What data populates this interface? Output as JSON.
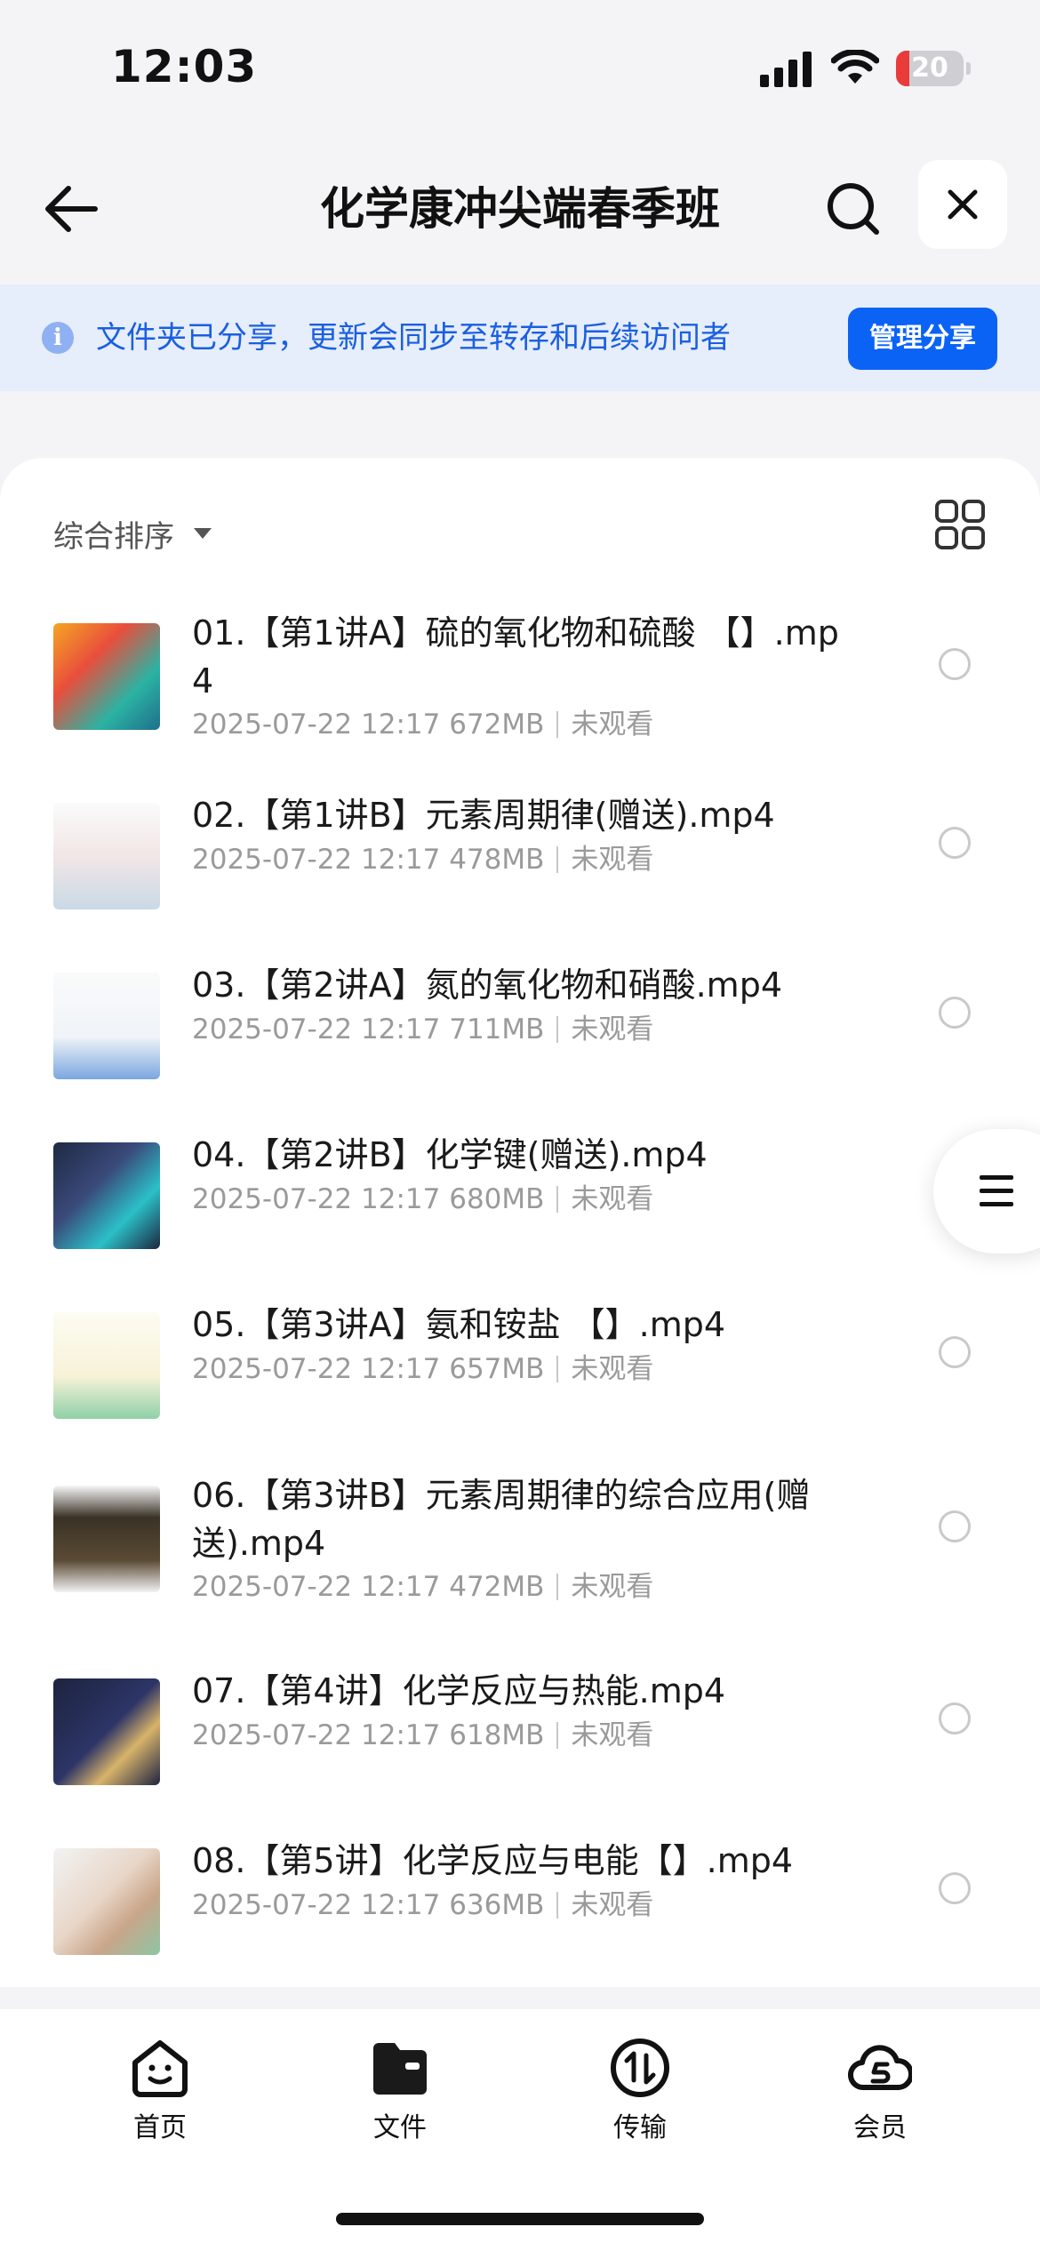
{
  "status_bar": {
    "time": "12:03",
    "battery_level": "20",
    "battery_fraction": 0.2,
    "icons": [
      "signal-icon",
      "wifi-icon",
      "battery-icon"
    ]
  },
  "header": {
    "title": "化学康冲尖端春季班",
    "icons": [
      "back-arrow-icon",
      "search-icon",
      "close-icon"
    ]
  },
  "share_banner": {
    "text": "文件夹已分享，更新会同步至转存和后续访问者",
    "button_label": "管理分享",
    "icon": "info-icon"
  },
  "sort": {
    "label": "综合排序",
    "icons": [
      "caret-down-icon",
      "grid-view-icon"
    ]
  },
  "files": [
    {
      "name": "01.【第1讲A】硫的氧化物和硫酸 【】.mp4",
      "date": "2025-07-22 12:17",
      "size": "672MB",
      "status": "未观看"
    },
    {
      "name": "02.【第1讲B】元素周期律(赠送).mp4",
      "date": "2025-07-22 12:17",
      "size": "478MB",
      "status": "未观看"
    },
    {
      "name": "03.【第2讲A】氮的氧化物和硝酸.mp4",
      "date": "2025-07-22 12:17",
      "size": "711MB",
      "status": "未观看"
    },
    {
      "name": "04.【第2讲B】化学键(赠送).mp4",
      "date": "2025-07-22 12:17",
      "size": "680MB",
      "status": "未观看"
    },
    {
      "name": "05.【第3讲A】氨和铵盐 【】.mp4",
      "date": "2025-07-22 12:17",
      "size": "657MB",
      "status": "未观看"
    },
    {
      "name": "06.【第3讲B】元素周期律的综合应用(赠送).mp4",
      "date": "2025-07-22 12:17",
      "size": "472MB",
      "status": "未观看"
    },
    {
      "name": "07.【第4讲】化学反应与热能.mp4",
      "date": "2025-07-22 12:17",
      "size": "618MB",
      "status": "未观看"
    },
    {
      "name": "08.【第5讲】化学反应与电能【】.mp4",
      "date": "2025-07-22 12:17",
      "size": "636MB",
      "status": "未观看"
    }
  ],
  "bottom_nav": {
    "items": [
      {
        "label": "首页",
        "icon": "home-face-icon"
      },
      {
        "label": "文件",
        "icon": "folder-icon",
        "active": true
      },
      {
        "label": "传输",
        "icon": "transfer-icon"
      },
      {
        "label": "会员",
        "icon": "member-cloud-icon"
      }
    ]
  },
  "colors": {
    "accent": "#0b63f6",
    "banner_bg": "#e6edfb",
    "banner_text": "#1a5fe0",
    "meta_text": "#9a9a9a",
    "battery_low": "#ea3b3b"
  }
}
